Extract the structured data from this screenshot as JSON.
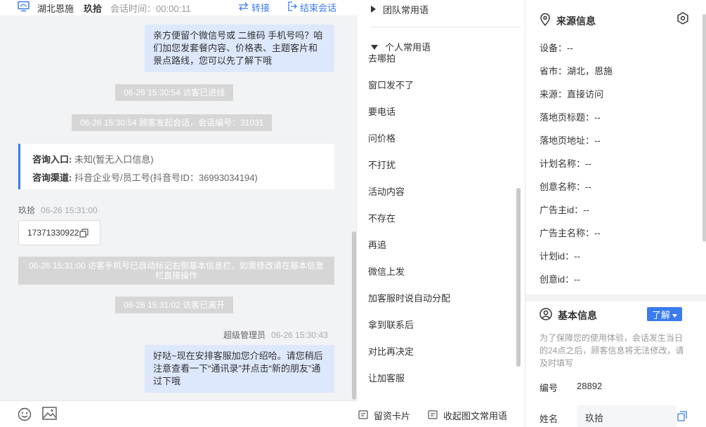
{
  "header": {
    "region": "湖北恩施",
    "visitor_name": "玖拾",
    "session_time": "会话时间：00:00:11",
    "transfer_label": "转接",
    "end_label": "结束会话"
  },
  "chat": {
    "msg_top": "亲方便留个微信号或 二维码 手机号吗？咱们加您发套餐内容、价格表、主题客片和景点路线，您可以先了解下哦",
    "sys_enter": "06-26 15:30:54 访客已进线",
    "sys_session": "06-26 15:30:54 顾客发起会话，会话编号：31031",
    "consult_entry_label": "咨询入口:",
    "consult_entry_value": " 未知(暂无入口信息)",
    "consult_channel_label": "咨询渠道:",
    "consult_channel_value": " 抖音企业号/员工号(抖音号ID：36993034194)",
    "visitor_name": "玖拾",
    "visitor_time": "06-26 15:31:00",
    "phone": "17371330922",
    "sys_phone_marked": "06-26 15:31:00 访客手机号已自动标记右侧基本信息栏，如需修改请在基本信息栏直接操作",
    "sys_leave": "06-26 15:31:02 访客已离开",
    "agent_name": "超级管理员",
    "agent_time": "06-26 15:30:43",
    "msg_bottom": "好哒~现在安排客服加您介绍哈。请您稍后注意查看一下“通讯录”并点击“新的朋友”通过下哦"
  },
  "phrases": {
    "team_group": "团队常用语",
    "personal_group": "个人常用语",
    "items": [
      "去哪拍",
      "窗口发不了",
      "要电话",
      "问价格",
      "不打扰",
      "活动内容",
      "不存在",
      "再追",
      "微信上发",
      "加客服时说自动分配",
      "拿到联系后",
      "对比再决定",
      "让加客服"
    ],
    "footer_card": "留资卡片",
    "footer_collapse": "收起图文常用语"
  },
  "info": {
    "source_title": "来源信息",
    "source_fields": [
      "设备：--",
      "省市：湖北，恩施",
      "来源：直接访问",
      "落地页标题：--",
      "落地页地址：--",
      "计划名称：--",
      "创意名称：--",
      "广告主id：--",
      "广告主名称：--",
      "计划id：--",
      "创意id：--"
    ],
    "basic_title": "基本信息",
    "learn_label": "了解",
    "notice": "为了保障您的使用体验，会话发生当日的24点之后，顾客信息将无法修改，请及时填写",
    "id_label": "编号",
    "id_value": "28892",
    "name_label": "姓名",
    "name_value": "玖拾"
  },
  "colors": {
    "accent": "#3a7bf0",
    "bubble": "#dde8fc",
    "system_pill": "#d6d6d6"
  },
  "icons": [
    "monitor-icon",
    "transfer-icon",
    "exit-icon",
    "copy-icon",
    "triangle-right-icon",
    "triangle-down-icon",
    "card-icon",
    "collapse-icon",
    "location-icon",
    "gear-icon",
    "user-circle-icon",
    "dropdown-caret-icon",
    "emoji-icon",
    "image-icon"
  ]
}
